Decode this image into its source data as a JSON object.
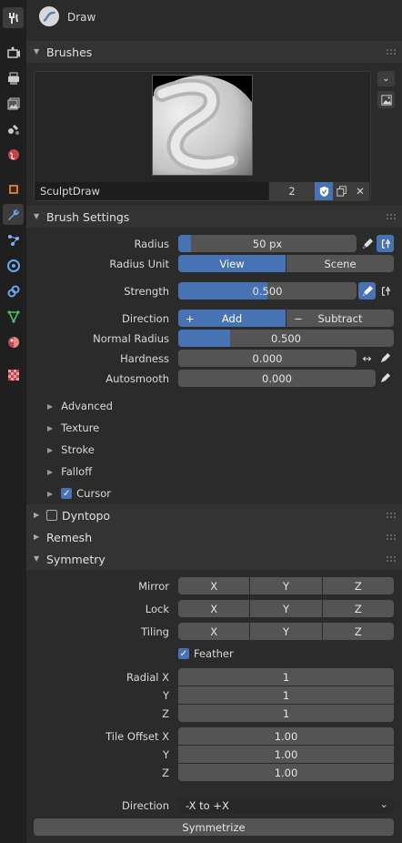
{
  "header": {
    "title": "Draw"
  },
  "brushes": {
    "title": "Brushes",
    "name": "SculptDraw",
    "users": "2"
  },
  "brush_settings": {
    "title": "Brush Settings",
    "radius": {
      "label": "Radius",
      "value": "50 px",
      "fill_pct": 7
    },
    "radius_unit": {
      "label": "Radius Unit",
      "options": [
        "View",
        "Scene"
      ],
      "selected": 0
    },
    "strength": {
      "label": "Strength",
      "value": "0.500",
      "fill_pct": 50
    },
    "direction": {
      "label": "Direction",
      "add": "Add",
      "subtract": "Subtract",
      "add_symbol": "+",
      "sub_symbol": "−"
    },
    "normal_radius": {
      "label": "Normal Radius",
      "value": "0.500",
      "fill_pct": 24
    },
    "hardness": {
      "label": "Hardness",
      "value": "0.000"
    },
    "autosmooth": {
      "label": "Autosmooth",
      "value": "0.000"
    },
    "subpanels": [
      "Advanced",
      "Texture",
      "Stroke",
      "Falloff"
    ],
    "cursor": "Cursor"
  },
  "dyntopo": {
    "title": "Dyntopo"
  },
  "remesh": {
    "title": "Remesh"
  },
  "symmetry": {
    "title": "Symmetry",
    "mirror": {
      "label": "Mirror",
      "axes": [
        "X",
        "Y",
        "Z"
      ]
    },
    "lock": {
      "label": "Lock",
      "axes": [
        "X",
        "Y",
        "Z"
      ]
    },
    "tiling": {
      "label": "Tiling",
      "axes": [
        "X",
        "Y",
        "Z"
      ]
    },
    "feather": "Feather",
    "radial": {
      "labels": [
        "Radial X",
        "Y",
        "Z"
      ],
      "values": [
        "1",
        "1",
        "1"
      ]
    },
    "tile_offset": {
      "labels": [
        "Tile Offset X",
        "Y",
        "Z"
      ],
      "values": [
        "1.00",
        "1.00",
        "1.00"
      ]
    },
    "direction": {
      "label": "Direction",
      "value": "-X to +X"
    },
    "symmetrize": "Symmetrize"
  },
  "colors": {
    "accent": "#4772b3",
    "field": "#545454",
    "panel_header": "#333333"
  }
}
